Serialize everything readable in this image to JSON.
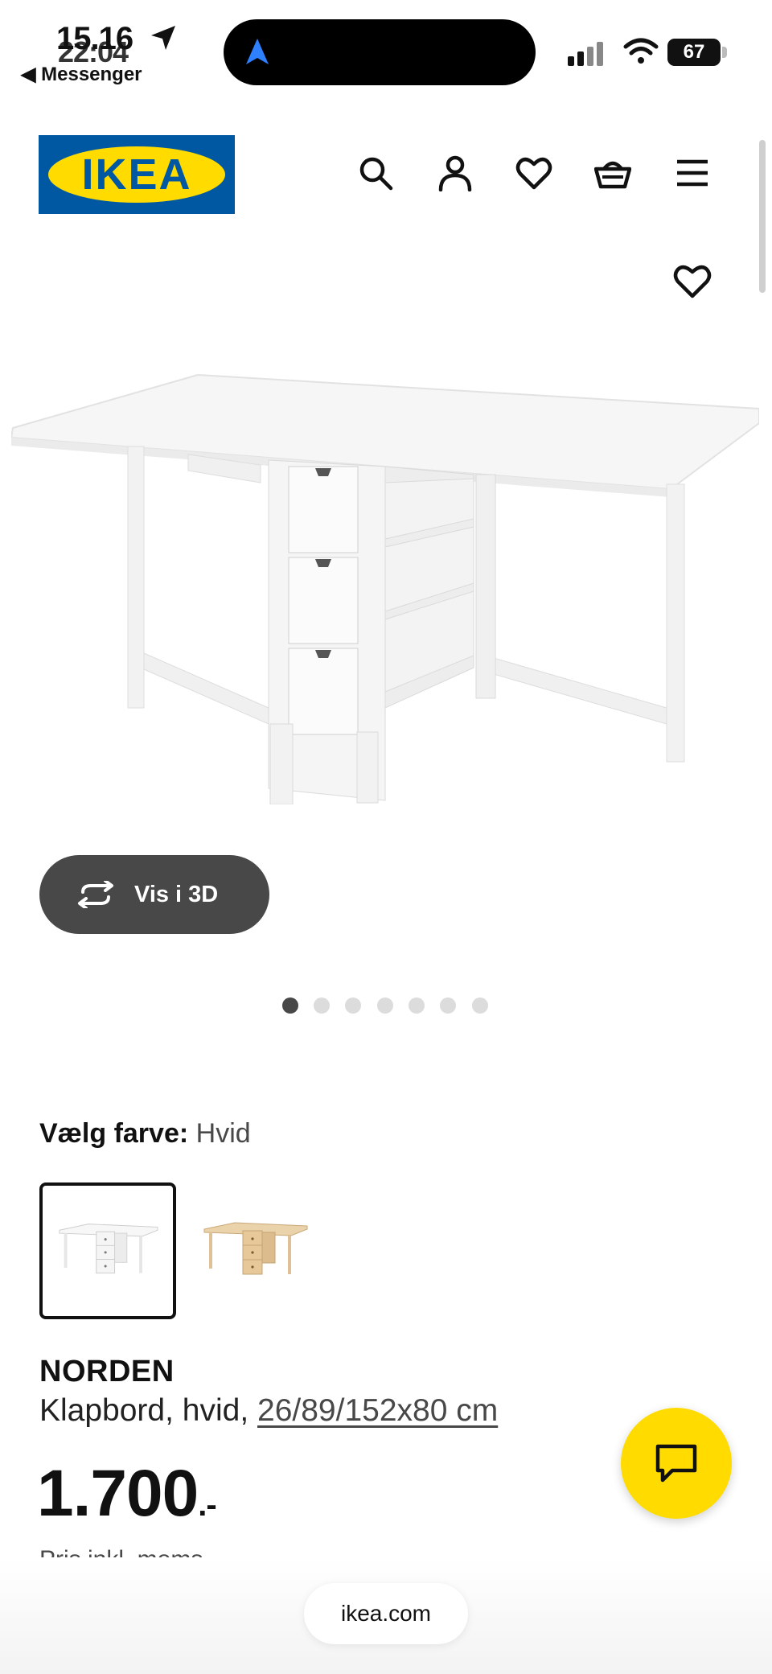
{
  "status_bar": {
    "time_primary": "15.16",
    "time_secondary": "22:04",
    "back_app": "◀ Messenger",
    "battery": "67"
  },
  "header": {
    "logo_text": "IKEA",
    "icons": [
      "search-icon",
      "user-icon",
      "heart-icon",
      "basket-icon",
      "menu-icon"
    ]
  },
  "gallery": {
    "view_3d_label": "Vis i 3D",
    "dot_count": 7,
    "active_dot": 0
  },
  "color_picker": {
    "label": "Vælg farve:",
    "selected": "Hvid",
    "options": [
      "Hvid",
      "Birk"
    ]
  },
  "product": {
    "name": "NORDEN",
    "description": "Klapbord, hvid,",
    "dimensions": "26/89/152x80 cm",
    "price": "1.700",
    "price_suffix": ".-",
    "price_note": "Pris inkl. moms"
  },
  "browser": {
    "url": "ikea.com"
  },
  "colors": {
    "ikea_blue": "#0058a3",
    "ikea_yellow": "#ffdb00",
    "button_dark": "#484848"
  }
}
